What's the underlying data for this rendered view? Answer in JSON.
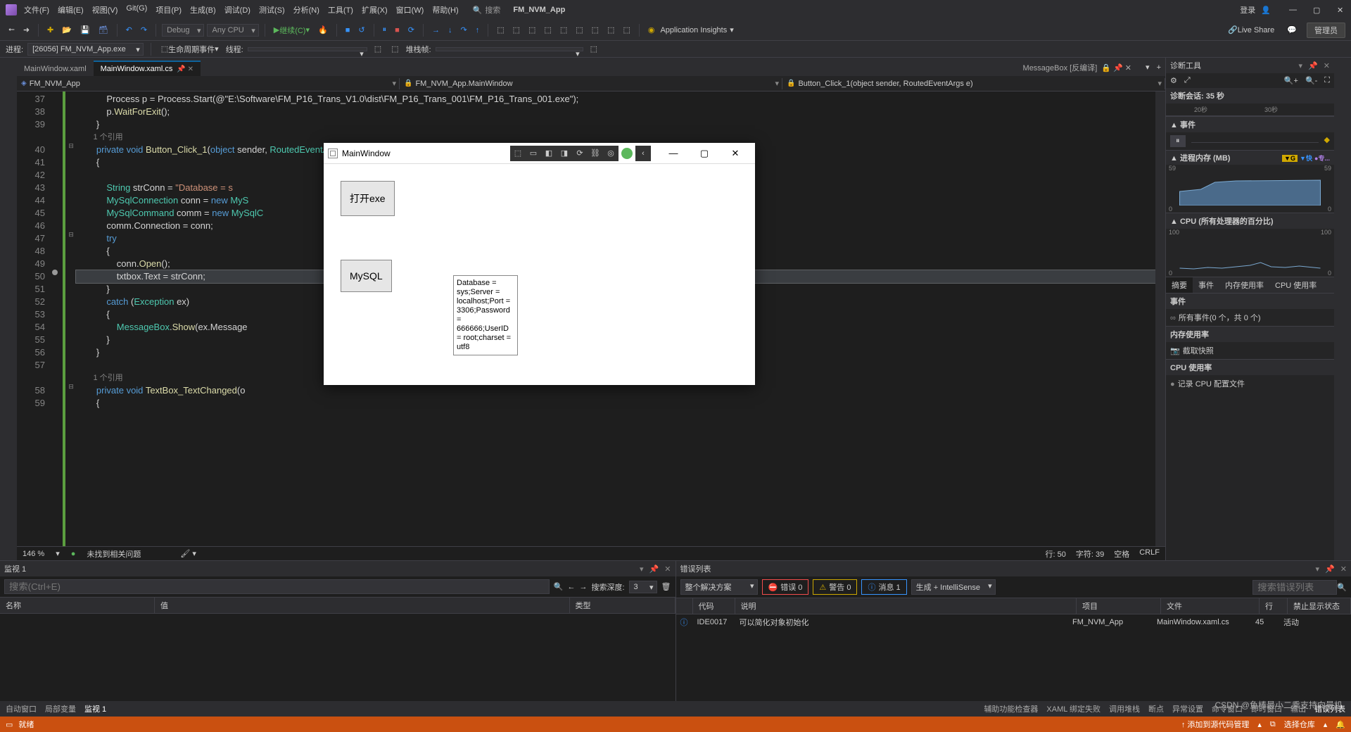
{
  "app": {
    "name": "FM_NVM_App",
    "login": "登录",
    "admin_btn": "管理员"
  },
  "menu": [
    "文件(F)",
    "编辑(E)",
    "视图(V)",
    "Git(G)",
    "项目(P)",
    "生成(B)",
    "调试(D)",
    "测试(S)",
    "分析(N)",
    "工具(T)",
    "扩展(X)",
    "窗口(W)",
    "帮助(H)"
  ],
  "search_placeholder": "搜索",
  "toolbar": {
    "config": "Debug",
    "platform": "Any CPU",
    "run_label": "继续(C)",
    "app_insights": "Application Insights",
    "live_share": "Live Share"
  },
  "processbar": {
    "label": "进程:",
    "process": "[26056] FM_NVM_App.exe",
    "life_events": "生命周期事件",
    "thread": "线程:",
    "stackframe": "堆栈帧:"
  },
  "doc_tabs": [
    {
      "label": "MainWindow.xaml",
      "active": false
    },
    {
      "label": "MainWindow.xaml.cs",
      "active": true
    }
  ],
  "message_box_tab": "MessageBox [反编译]",
  "nav": {
    "seg1": "FM_NVM_App",
    "seg2": "FM_NVM_App.MainWindow",
    "seg3": "Button_Click_1(object sender, RoutedEventArgs e)"
  },
  "code": {
    "line_start": 37,
    "lines": [
      {
        "n": 37,
        "frag": [
          {
            "c": "pn",
            "t": "            Process p = Process.Start(@\"E:\\Software\\FM_P16_Trans_V1.0\\dist\\FM_P16_Trans_001\\FM_P16_Trans_001.exe\");"
          }
        ]
      },
      {
        "n": 38,
        "frag": [
          {
            "c": "pn",
            "t": "            p."
          },
          {
            "c": "mtd",
            "t": "WaitForExit"
          },
          {
            "c": "pn",
            "t": "();"
          }
        ]
      },
      {
        "n": 39,
        "frag": [
          {
            "c": "pn",
            "t": "        }"
          }
        ]
      },
      {
        "ref": "        1 个引用"
      },
      {
        "n": 40,
        "fold": true,
        "frag": [
          {
            "c": "pn",
            "t": "        "
          },
          {
            "c": "kw",
            "t": "private"
          },
          {
            "c": "pn",
            "t": " "
          },
          {
            "c": "kw",
            "t": "void"
          },
          {
            "c": "pn",
            "t": " "
          },
          {
            "c": "mtd",
            "t": "Button_Click_1"
          },
          {
            "c": "pn",
            "t": "("
          },
          {
            "c": "kw",
            "t": "object"
          },
          {
            "c": "pn",
            "t": " sender, "
          },
          {
            "c": "cl",
            "t": "RoutedEventArgs"
          },
          {
            "c": "pn",
            "t": " e)"
          }
        ]
      },
      {
        "n": 41,
        "frag": [
          {
            "c": "pn",
            "t": "        {"
          }
        ]
      },
      {
        "n": 42,
        "frag": [
          {
            "c": "pn",
            "t": ""
          }
        ]
      },
      {
        "n": 43,
        "frag": [
          {
            "c": "pn",
            "t": "            "
          },
          {
            "c": "cl",
            "t": "String"
          },
          {
            "c": "pn",
            "t": " strConn = "
          },
          {
            "c": "str",
            "t": "\"Database = s"
          }
        ]
      },
      {
        "n": 44,
        "frag": [
          {
            "c": "pn",
            "t": "            "
          },
          {
            "c": "cl",
            "t": "MySqlConnection"
          },
          {
            "c": "pn",
            "t": " conn = "
          },
          {
            "c": "kw",
            "t": "new"
          },
          {
            "c": "pn",
            "t": " "
          },
          {
            "c": "cl",
            "t": "MyS"
          }
        ]
      },
      {
        "n": 45,
        "frag": [
          {
            "c": "pn",
            "t": "            "
          },
          {
            "c": "cl",
            "t": "MySqlCommand"
          },
          {
            "c": "pn",
            "t": " comm = "
          },
          {
            "c": "kw",
            "t": "new"
          },
          {
            "c": "pn",
            "t": " "
          },
          {
            "c": "cl",
            "t": "MySqlC"
          }
        ]
      },
      {
        "n": 46,
        "frag": [
          {
            "c": "pn",
            "t": "            comm.Connection = conn;"
          }
        ]
      },
      {
        "n": 47,
        "fold": true,
        "frag": [
          {
            "c": "pn",
            "t": "            "
          },
          {
            "c": "kw",
            "t": "try"
          }
        ]
      },
      {
        "n": 48,
        "frag": [
          {
            "c": "pn",
            "t": "            {"
          }
        ]
      },
      {
        "n": 49,
        "frag": [
          {
            "c": "pn",
            "t": "                conn."
          },
          {
            "c": "mtd",
            "t": "Open"
          },
          {
            "c": "pn",
            "t": "();"
          }
        ]
      },
      {
        "n": 50,
        "current": true,
        "bp": true,
        "frag": [
          {
            "c": "pn",
            "t": "                txtbox.Text = strConn;"
          }
        ]
      },
      {
        "n": 51,
        "frag": [
          {
            "c": "pn",
            "t": "            }"
          }
        ]
      },
      {
        "n": 52,
        "frag": [
          {
            "c": "pn",
            "t": "            "
          },
          {
            "c": "kw",
            "t": "catch"
          },
          {
            "c": "pn",
            "t": " ("
          },
          {
            "c": "cl",
            "t": "Exception"
          },
          {
            "c": "pn",
            "t": " ex)"
          }
        ]
      },
      {
        "n": 53,
        "frag": [
          {
            "c": "pn",
            "t": "            {"
          }
        ]
      },
      {
        "n": 54,
        "frag": [
          {
            "c": "pn",
            "t": "                "
          },
          {
            "c": "cl",
            "t": "MessageBox"
          },
          {
            "c": "pn",
            "t": "."
          },
          {
            "c": "mtd",
            "t": "Show"
          },
          {
            "c": "pn",
            "t": "(ex.Message"
          }
        ]
      },
      {
        "n": 55,
        "frag": [
          {
            "c": "pn",
            "t": "            }"
          }
        ]
      },
      {
        "n": 56,
        "frag": [
          {
            "c": "pn",
            "t": "        }"
          }
        ]
      },
      {
        "n": 57,
        "frag": [
          {
            "c": "pn",
            "t": ""
          }
        ]
      },
      {
        "ref": "        1 个引用"
      },
      {
        "n": 58,
        "fold": true,
        "frag": [
          {
            "c": "pn",
            "t": "        "
          },
          {
            "c": "kw",
            "t": "private"
          },
          {
            "c": "pn",
            "t": " "
          },
          {
            "c": "kw",
            "t": "void"
          },
          {
            "c": "pn",
            "t": " "
          },
          {
            "c": "mtd",
            "t": "TextBox_TextChanged"
          },
          {
            "c": "pn",
            "t": "(o"
          }
        ]
      },
      {
        "n": 59,
        "frag": [
          {
            "c": "pn",
            "t": "        {"
          }
        ]
      }
    ]
  },
  "statusline": {
    "zoom": "146 %",
    "issues": "未找到相关问题",
    "line": "行: 50",
    "col": "字符: 39",
    "spaces": "空格",
    "crlf": "CRLF"
  },
  "diag": {
    "title": "诊断工具",
    "session": "诊断会话: 35 秒",
    "tl_ticks": [
      "20秒",
      "30秒"
    ],
    "events_hdr": "事件",
    "mem_hdr": "进程内存 (MB)",
    "mem_badges": [
      "G",
      "快",
      "专..."
    ],
    "mem_max": "59",
    "mem_min": "0",
    "cpu_hdr": "CPU (所有处理器的百分比)",
    "cpu_max": "100",
    "cpu_min": "0",
    "tabs": [
      "摘要",
      "事件",
      "内存使用率",
      "CPU 使用率"
    ],
    "events_sec": "事件",
    "events_body": "所有事件(0 个，共 0 个)",
    "mem_sec": "内存使用率",
    "mem_body": "截取快照",
    "cpu_sec": "CPU 使用率",
    "cpu_body": "记录 CPU 配置文件"
  },
  "chart_data": [
    {
      "type": "area",
      "title": "进程内存 (MB)",
      "ylim": [
        0,
        59
      ],
      "x": [
        0,
        5,
        10,
        15,
        20,
        25,
        30,
        35
      ],
      "values": [
        40,
        42,
        48,
        50,
        51,
        51,
        51,
        51
      ]
    },
    {
      "type": "line",
      "title": "CPU (所有处理器的百分比)",
      "ylim": [
        0,
        100
      ],
      "x": [
        0,
        5,
        10,
        15,
        20,
        25,
        30,
        35
      ],
      "values": [
        2,
        1,
        3,
        2,
        4,
        8,
        6,
        3
      ]
    }
  ],
  "watch": {
    "title": "监视 1",
    "search_ph": "搜索(Ctrl+E)",
    "depth_label": "搜索深度:",
    "depth": "3",
    "cols": [
      "名称",
      "值",
      "类型"
    ]
  },
  "errorlist": {
    "title": "错误列表",
    "scope": "整个解决方案",
    "errors": "错误 0",
    "warnings": "警告 0",
    "infos": "消息 1",
    "source": "生成 + IntelliSense",
    "search_ph": "搜索错误列表",
    "cols": [
      "",
      "代码",
      "说明",
      "项目",
      "文件",
      "行",
      "禁止显示状态"
    ],
    "rows": [
      {
        "icon": "info",
        "code": "IDE0017",
        "desc": "可以简化对象初始化",
        "project": "FM_NVM_App",
        "file": "MainWindow.xaml.cs",
        "line": "45",
        "suppress": "活动"
      }
    ]
  },
  "footer_tabs_left": [
    "自动窗口",
    "局部变量",
    "监视 1"
  ],
  "footer_tabs_right": [
    "辅助功能检查器",
    "XAML 绑定失败",
    "调用堆栈",
    "断点",
    "异常设置",
    "命令窗口",
    "即时窗口",
    "输出",
    "错误列表"
  ],
  "status_bottom": {
    "state": "就绪",
    "right1": "↑ 添加到源代码管理",
    "right2": "选择仓库",
    "watermark": "CSDN @鱼棒最小二乘支持向量机"
  },
  "debug_window": {
    "title": "MainWindow",
    "btn1": "打开exe",
    "btn2": "MySQL",
    "textbox": "Database = sys;Server = localhost;Port = 3306;Password = 666666;UserID = root;charset = utf8"
  }
}
